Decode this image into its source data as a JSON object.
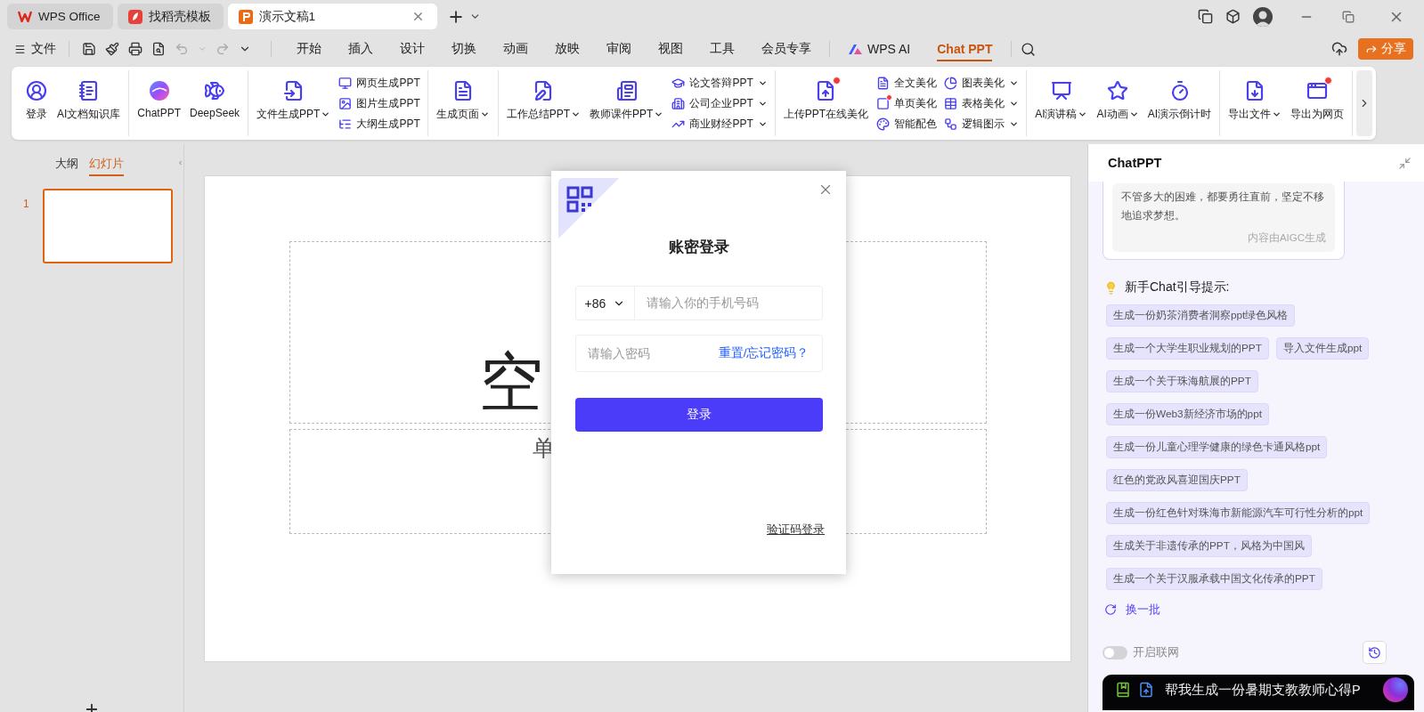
{
  "tabs": [
    {
      "label": "WPS Office",
      "selected": false
    },
    {
      "label": "找稻壳模板",
      "selected": false
    },
    {
      "label": "演示文稿1",
      "selected": true
    }
  ],
  "file_menu": "文件",
  "menu_tabs": [
    {
      "kind": "text",
      "label": "开始",
      "selected": false
    },
    {
      "kind": "text",
      "label": "插入",
      "selected": false
    },
    {
      "kind": "text",
      "label": "设计",
      "selected": false
    },
    {
      "kind": "text",
      "label": "切换",
      "selected": false
    },
    {
      "kind": "text",
      "label": "动画",
      "selected": false
    },
    {
      "kind": "text",
      "label": "放映",
      "selected": false
    },
    {
      "kind": "text",
      "label": "审阅",
      "selected": false
    },
    {
      "kind": "text",
      "label": "视图",
      "selected": false
    },
    {
      "kind": "text",
      "label": "工具",
      "selected": false
    },
    {
      "kind": "text",
      "label": "会员专享",
      "selected": false
    },
    {
      "kind": "logo",
      "label": "WPS AI",
      "selected": false
    },
    {
      "kind": "text",
      "label": "Chat PPT",
      "selected": true
    }
  ],
  "share_button": "分享",
  "ribbon": [
    {
      "items": [
        {
          "kind": "large",
          "label": "登录",
          "dropdown": false,
          "badge": false
        },
        {
          "kind": "large",
          "label": "AI文档知识库",
          "dropdown": false,
          "badge": false
        }
      ]
    },
    {
      "items": [
        {
          "kind": "large",
          "label": "ChatPPT",
          "dropdown": false,
          "badge": false
        },
        {
          "kind": "large",
          "label": "DeepSeek",
          "dropdown": false,
          "badge": false
        }
      ]
    },
    {
      "items": [
        {
          "kind": "large",
          "label": "文件生成PPT",
          "dropdown": true,
          "badge": false
        },
        {
          "kind": "stack",
          "items": [
            {
              "label": "网页生成PPT",
              "dropdown": false,
              "badge": false
            },
            {
              "label": "图片生成PPT",
              "dropdown": false,
              "badge": false
            },
            {
              "label": "大纲生成PPT",
              "dropdown": false,
              "badge": false
            }
          ]
        }
      ]
    },
    {
      "items": [
        {
          "kind": "large",
          "label": "生成页面",
          "dropdown": true,
          "badge": false
        }
      ]
    },
    {
      "items": [
        {
          "kind": "large",
          "label": "工作总结PPT",
          "dropdown": true,
          "badge": false
        },
        {
          "kind": "large",
          "label": "教师课件PPT",
          "dropdown": true,
          "badge": false
        },
        {
          "kind": "stack",
          "items": [
            {
              "label": "论文答辩PPT",
              "dropdown": true,
              "badge": false
            },
            {
              "label": "公司企业PPT",
              "dropdown": true,
              "badge": false
            },
            {
              "label": "商业财经PPT",
              "dropdown": true,
              "badge": false
            }
          ]
        }
      ]
    },
    {
      "items": [
        {
          "kind": "large",
          "label": "上传PPT在线美化",
          "dropdown": false,
          "badge": true
        },
        {
          "kind": "stack",
          "items": [
            {
              "label": "全文美化",
              "dropdown": false,
              "badge": false
            },
            {
              "label": "单页美化",
              "dropdown": false,
              "badge": true
            },
            {
              "label": "智能配色",
              "dropdown": false,
              "badge": false
            }
          ]
        },
        {
          "kind": "stack",
          "items": [
            {
              "label": "图表美化",
              "dropdown": true,
              "badge": false
            },
            {
              "label": "表格美化",
              "dropdown": true,
              "badge": false
            },
            {
              "label": "逻辑图示",
              "dropdown": true,
              "badge": false
            }
          ]
        }
      ]
    },
    {
      "items": [
        {
          "kind": "large",
          "label": "AI演讲稿",
          "dropdown": true,
          "badge": false
        },
        {
          "kind": "large",
          "label": "AI动画",
          "dropdown": true,
          "badge": false
        },
        {
          "kind": "large",
          "label": "AI演示倒计时",
          "dropdown": false,
          "badge": false
        }
      ]
    },
    {
      "items": [
        {
          "kind": "large",
          "label": "导出文件",
          "dropdown": true,
          "badge": false
        },
        {
          "kind": "large",
          "label": "导出为网页",
          "dropdown": false,
          "badge": true
        }
      ]
    }
  ],
  "side_panel": {
    "tabs": [
      {
        "label": "大纲",
        "selected": false
      },
      {
        "label": "幻灯片",
        "selected": true
      }
    ],
    "slides": [
      {
        "number": "1",
        "selected": true
      }
    ]
  },
  "slide": {
    "title": "空",
    "subtitle": "单"
  },
  "login_dialog": {
    "title": "账密登录",
    "country_code": "+86",
    "phone_placeholder": "请输入你的手机号码",
    "password_placeholder": "请输入密码",
    "forgot_link": "重置/忘记密码？",
    "login_button": "登录",
    "code_login_link": "验证码登录"
  },
  "chat_panel": {
    "title": "ChatPPT",
    "quote": "不管多大的困难，都要勇往直前，坚定不移地追求梦想。",
    "quote_note": "内容由AIGC生成",
    "tips_heading": "新手Chat引导提示:",
    "prompt_rows": [
      [
        "生成一份奶茶消费者洞察ppt绿色风格"
      ],
      [
        "生成一个大学生职业规划的PPT",
        "导入文件生成ppt"
      ],
      [
        "生成一个关于珠海航展的PPT"
      ],
      [
        "生成一份Web3新经济市场的ppt"
      ],
      [
        "生成一份儿童心理学健康的绿色卡通风格ppt"
      ],
      [
        "红色的党政风喜迎国庆PPT"
      ],
      [
        "生成一份红色针对珠海市新能源汽车可行性分析的ppt"
      ],
      [
        "生成关于非遗传承的PPT，风格为中国风"
      ],
      [
        "生成一个关于汉服承载中国文化传承的PPT"
      ]
    ],
    "refresh": "换一批",
    "online": {
      "label": "开启联网",
      "on": false
    },
    "input_value": "帮我生成一份暑期支教教师心得P"
  }
}
